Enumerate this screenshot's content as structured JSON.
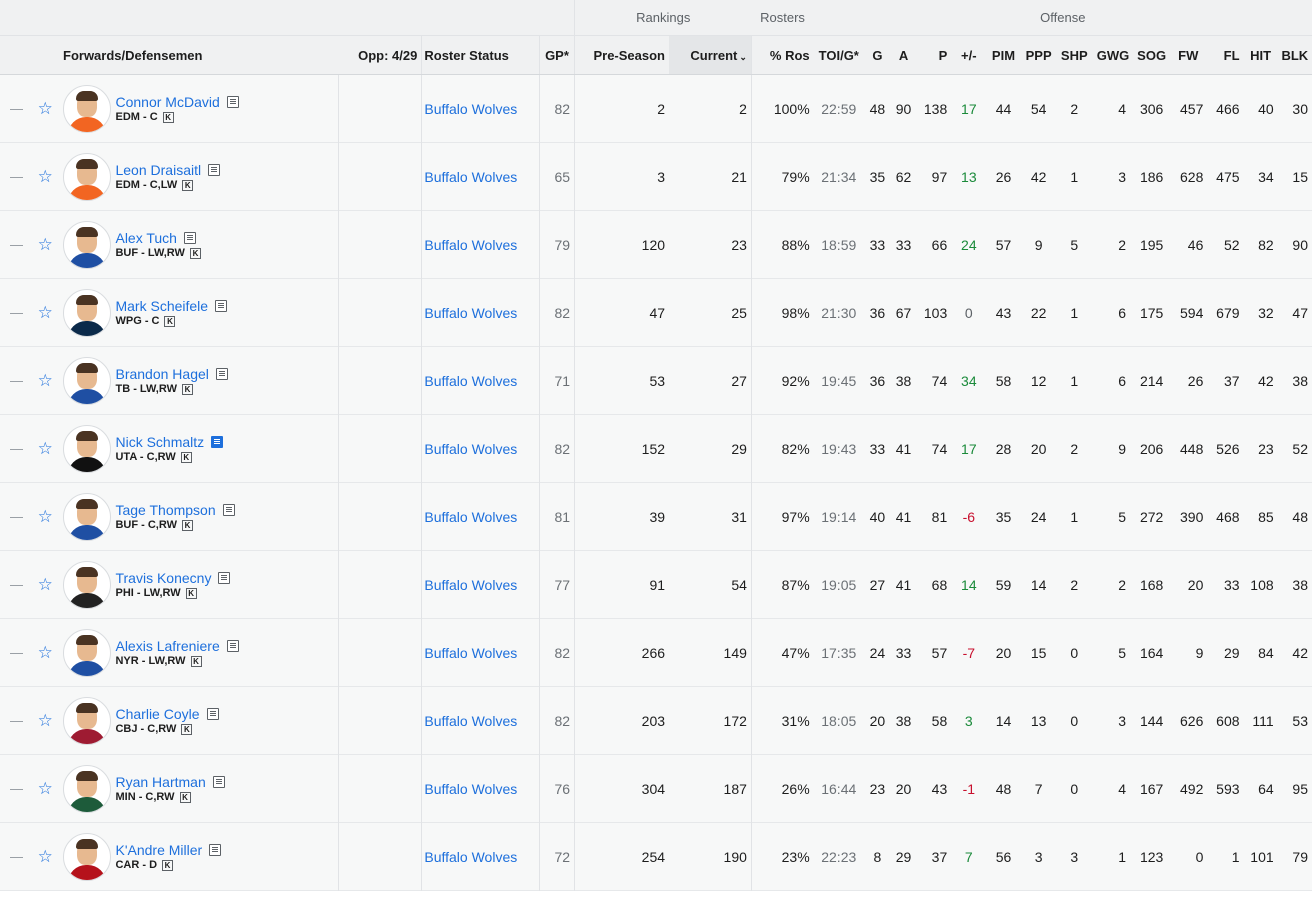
{
  "header": {
    "groups": {
      "rankings": "Rankings",
      "rosters": "Rosters",
      "offense": "Offense"
    },
    "columns": {
      "player": "Forwards/Defensemen",
      "opp": "Opp: 4/29",
      "roster_status": "Roster Status",
      "gp": "GP*",
      "preseason": "Pre-Season",
      "current": "Current",
      "pct_ros": "% Ros",
      "toi": "TOI/G*",
      "g": "G",
      "a": "A",
      "p": "P",
      "pm": "+/-",
      "pim": "PIM",
      "ppp": "PPP",
      "shp": "SHP",
      "gwg": "GWG",
      "sog": "SOG",
      "fw": "FW",
      "fl": "FL",
      "hit": "HIT",
      "blk": "BLK"
    },
    "sort_icon": "chevron-down-icon"
  },
  "colors": {
    "link": "#1d6fdc",
    "positive": "#1a8a3a",
    "negative": "#c8102e",
    "header_bg": "#f0f1f2"
  },
  "players": [
    {
      "name": "Connor McDavid",
      "meta": "EDM - C",
      "status": "Buffalo Wolves",
      "gp": "82",
      "pre": "2",
      "cur": "2",
      "ros": "100%",
      "toi": "22:59",
      "g": "48",
      "a": "90",
      "p": "138",
      "pm": "17",
      "pm_sign": "pos",
      "pim": "44",
      "ppp": "54",
      "shp": "2",
      "gwg": "4",
      "sog": "306",
      "fw": "457",
      "fl": "466",
      "hit": "40",
      "blk": "30",
      "jersey": "#f26522",
      "note_active": false
    },
    {
      "name": "Leon Draisaitl",
      "meta": "EDM - C,LW",
      "status": "Buffalo Wolves",
      "gp": "65",
      "pre": "3",
      "cur": "21",
      "ros": "79%",
      "toi": "21:34",
      "g": "35",
      "a": "62",
      "p": "97",
      "pm": "13",
      "pm_sign": "pos",
      "pim": "26",
      "ppp": "42",
      "shp": "1",
      "gwg": "3",
      "sog": "186",
      "fw": "628",
      "fl": "475",
      "hit": "34",
      "blk": "15",
      "jersey": "#f26522",
      "note_active": false
    },
    {
      "name": "Alex Tuch",
      "meta": "BUF - LW,RW",
      "status": "Buffalo Wolves",
      "gp": "79",
      "pre": "120",
      "cur": "23",
      "ros": "88%",
      "toi": "18:59",
      "g": "33",
      "a": "33",
      "p": "66",
      "pm": "24",
      "pm_sign": "pos",
      "pim": "57",
      "ppp": "9",
      "shp": "5",
      "gwg": "2",
      "sog": "195",
      "fw": "46",
      "fl": "52",
      "hit": "82",
      "blk": "90",
      "jersey": "#1f4fa3",
      "note_active": false
    },
    {
      "name": "Mark Scheifele",
      "meta": "WPG - C",
      "status": "Buffalo Wolves",
      "gp": "82",
      "pre": "47",
      "cur": "25",
      "ros": "98%",
      "toi": "21:30",
      "g": "36",
      "a": "67",
      "p": "103",
      "pm": "0",
      "pm_sign": "zero",
      "pim": "43",
      "ppp": "22",
      "shp": "1",
      "gwg": "6",
      "sog": "175",
      "fw": "594",
      "fl": "679",
      "hit": "32",
      "blk": "47",
      "jersey": "#0b2a4a",
      "note_active": false
    },
    {
      "name": "Brandon Hagel",
      "meta": "TB - LW,RW",
      "status": "Buffalo Wolves",
      "gp": "71",
      "pre": "53",
      "cur": "27",
      "ros": "92%",
      "toi": "19:45",
      "g": "36",
      "a": "38",
      "p": "74",
      "pm": "34",
      "pm_sign": "pos",
      "pim": "58",
      "ppp": "12",
      "shp": "1",
      "gwg": "6",
      "sog": "214",
      "fw": "26",
      "fl": "37",
      "hit": "42",
      "blk": "38",
      "jersey": "#1f4fa3",
      "note_active": false
    },
    {
      "name": "Nick Schmaltz",
      "meta": "UTA - C,RW",
      "status": "Buffalo Wolves",
      "gp": "82",
      "pre": "152",
      "cur": "29",
      "ros": "82%",
      "toi": "19:43",
      "g": "33",
      "a": "41",
      "p": "74",
      "pm": "17",
      "pm_sign": "pos",
      "pim": "28",
      "ppp": "20",
      "shp": "2",
      "gwg": "9",
      "sog": "206",
      "fw": "448",
      "fl": "526",
      "hit": "23",
      "blk": "52",
      "jersey": "#111111",
      "note_active": true
    },
    {
      "name": "Tage Thompson",
      "meta": "BUF - C,RW",
      "status": "Buffalo Wolves",
      "gp": "81",
      "pre": "39",
      "cur": "31",
      "ros": "97%",
      "toi": "19:14",
      "g": "40",
      "a": "41",
      "p": "81",
      "pm": "-6",
      "pm_sign": "neg",
      "pim": "35",
      "ppp": "24",
      "shp": "1",
      "gwg": "5",
      "sog": "272",
      "fw": "390",
      "fl": "468",
      "hit": "85",
      "blk": "48",
      "jersey": "#1f4fa3",
      "note_active": false
    },
    {
      "name": "Travis Konecny",
      "meta": "PHI - LW,RW",
      "status": "Buffalo Wolves",
      "gp": "77",
      "pre": "91",
      "cur": "54",
      "ros": "87%",
      "toi": "19:05",
      "g": "27",
      "a": "41",
      "p": "68",
      "pm": "14",
      "pm_sign": "pos",
      "pim": "59",
      "ppp": "14",
      "shp": "2",
      "gwg": "2",
      "sog": "168",
      "fw": "20",
      "fl": "33",
      "hit": "108",
      "blk": "38",
      "jersey": "#222222",
      "note_active": false
    },
    {
      "name": "Alexis Lafreniere",
      "meta": "NYR - LW,RW",
      "status": "Buffalo Wolves",
      "gp": "82",
      "pre": "266",
      "cur": "149",
      "ros": "47%",
      "toi": "17:35",
      "g": "24",
      "a": "33",
      "p": "57",
      "pm": "-7",
      "pm_sign": "neg",
      "pim": "20",
      "ppp": "15",
      "shp": "0",
      "gwg": "5",
      "sog": "164",
      "fw": "9",
      "fl": "29",
      "hit": "84",
      "blk": "42",
      "jersey": "#1f4fa3",
      "note_active": false
    },
    {
      "name": "Charlie Coyle",
      "meta": "CBJ - C,RW",
      "status": "Buffalo Wolves",
      "gp": "82",
      "pre": "203",
      "cur": "172",
      "ros": "31%",
      "toi": "18:05",
      "g": "20",
      "a": "38",
      "p": "58",
      "pm": "3",
      "pm_sign": "pos",
      "pim": "14",
      "ppp": "13",
      "shp": "0",
      "gwg": "3",
      "sog": "144",
      "fw": "626",
      "fl": "608",
      "hit": "111",
      "blk": "53",
      "jersey": "#9e1b32",
      "note_active": false
    },
    {
      "name": "Ryan Hartman",
      "meta": "MIN - C,RW",
      "status": "Buffalo Wolves",
      "gp": "76",
      "pre": "304",
      "cur": "187",
      "ros": "26%",
      "toi": "16:44",
      "g": "23",
      "a": "20",
      "p": "43",
      "pm": "-1",
      "pm_sign": "neg",
      "pim": "48",
      "ppp": "7",
      "shp": "0",
      "gwg": "4",
      "sog": "167",
      "fw": "492",
      "fl": "593",
      "hit": "64",
      "blk": "95",
      "jersey": "#1d5b3a",
      "note_active": false
    },
    {
      "name": "K'Andre Miller",
      "meta": "CAR - D",
      "status": "Buffalo Wolves",
      "gp": "72",
      "pre": "254",
      "cur": "190",
      "ros": "23%",
      "toi": "22:23",
      "g": "8",
      "a": "29",
      "p": "37",
      "pm": "7",
      "pm_sign": "pos",
      "pim": "56",
      "ppp": "3",
      "shp": "3",
      "gwg": "1",
      "sog": "123",
      "fw": "0",
      "fl": "1",
      "hit": "101",
      "blk": "79",
      "jersey": "#b5121b",
      "note_active": false
    }
  ]
}
